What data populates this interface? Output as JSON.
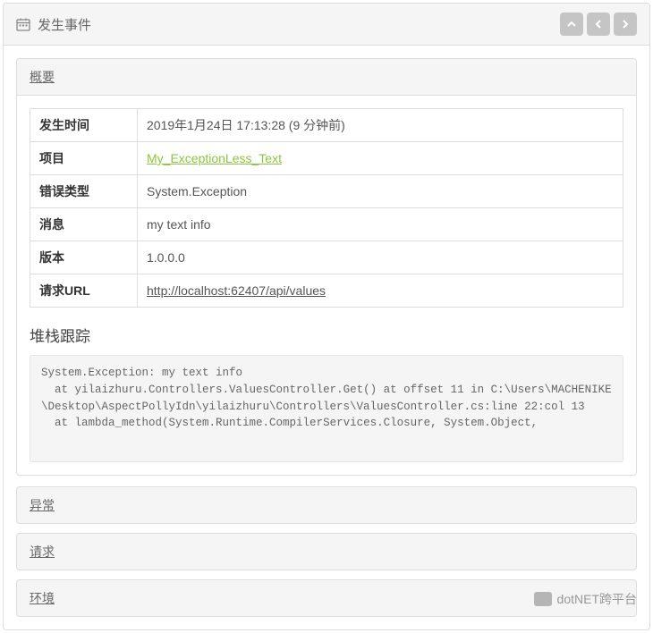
{
  "header": {
    "title": "发生事件"
  },
  "overview": {
    "heading": "概要",
    "rows": {
      "time_label": "发生时间",
      "time_value": "2019年1月24日 17:13:28 (9 分钟前)",
      "project_label": "项目",
      "project_value": "My_ExceptionLess_Text",
      "type_label": "错误类型",
      "type_value": "System.Exception",
      "message_label": "消息",
      "message_value": "my text info",
      "version_label": "版本",
      "version_value": "1.0.0.0",
      "url_label": "请求URL",
      "url_value": "http://localhost:62407/api/values"
    }
  },
  "stack": {
    "heading": "堆栈跟踪",
    "trace": "System.Exception: my text info\n  at yilaizhuru.Controllers.ValuesController.Get() at offset 11 in C:\\Users\\MACHENIKE\\Desktop\\AspectPollyIdn\\yilaizhuru\\Controllers\\ValuesController.cs:line 22:col 13\n  at lambda_method(System.Runtime.CompilerServices.Closure, System.Object,"
  },
  "collapsed": {
    "exception": "异常",
    "request": "请求",
    "env": "环境"
  },
  "watermark": "dotNET跨平台"
}
